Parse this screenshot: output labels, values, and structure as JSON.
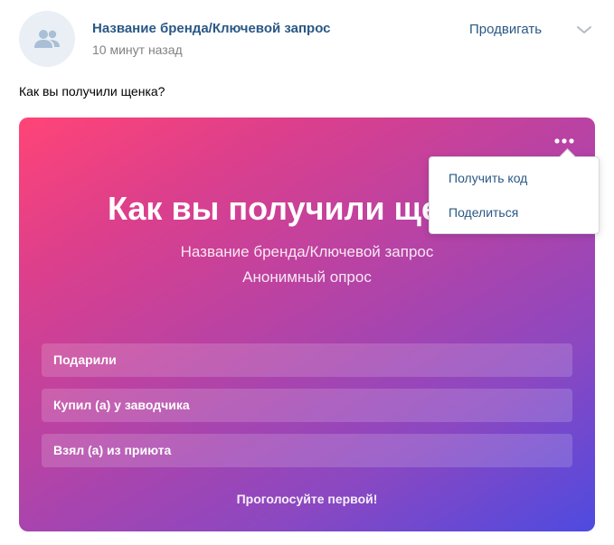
{
  "post": {
    "author": "Название бренда/Ключевой запрос",
    "time": "10 минут назад",
    "promote_label": "Продвигать",
    "text": "Как вы получили щенка?"
  },
  "poll": {
    "title": "Как вы получили щенка?",
    "subtitle": "Название бренда/Ключевой запрос",
    "type_label": "Анонимный опрос",
    "options": [
      {
        "label": "Подарили"
      },
      {
        "label": "Купил (а) у заводчика"
      },
      {
        "label": "Взял (а) из приюта"
      }
    ],
    "footer": "Проголосуйте первой!",
    "gradient_start": "#ff4477",
    "gradient_end": "#4e4ae0"
  },
  "menu": {
    "items": [
      {
        "label": "Получить код"
      },
      {
        "label": "Поделиться"
      }
    ]
  },
  "colors": {
    "link": "#2a5885",
    "secondary_text": "#828282"
  },
  "icons": {
    "avatar": "users-icon",
    "expand": "chevron-down-icon",
    "poll_menu": "more-horizontal-icon"
  }
}
